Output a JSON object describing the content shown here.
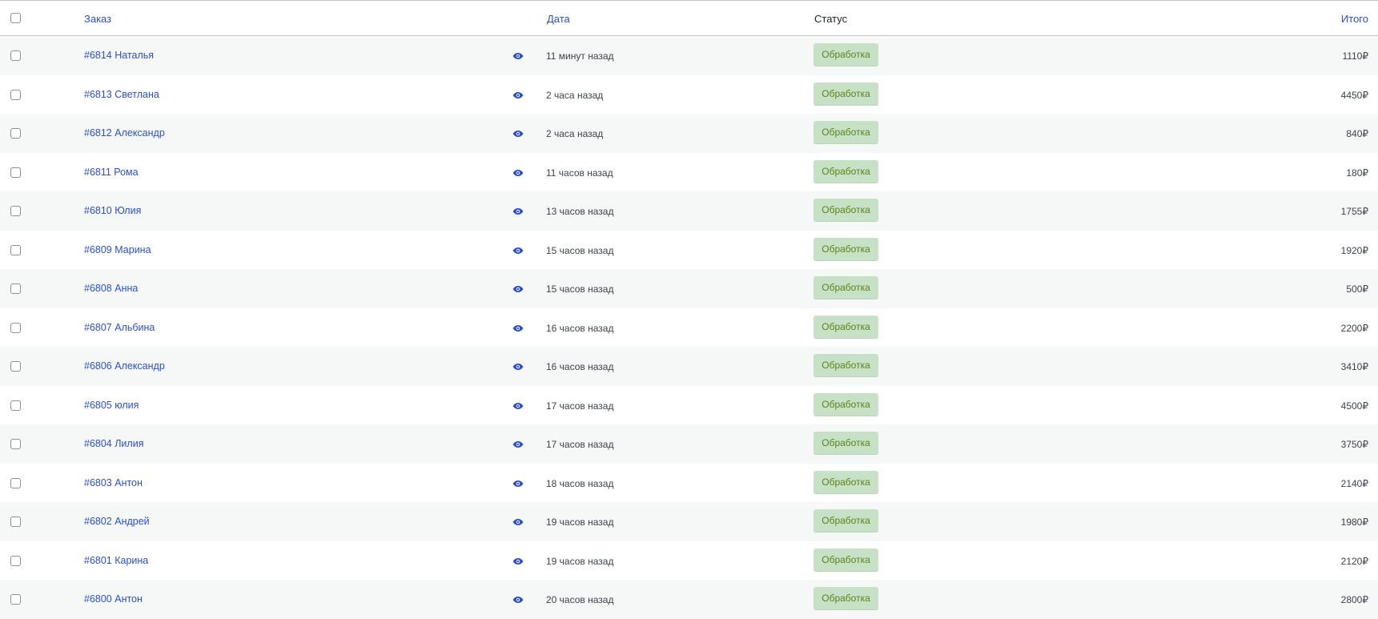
{
  "table": {
    "headers": {
      "order": "Заказ",
      "date": "Дата",
      "status": "Статус",
      "total": "Итого"
    },
    "preview_icon": "eye-icon",
    "status_color": "#c6e1c6",
    "status_text_color": "#5b841b",
    "link_color": "#2c4fd1",
    "rows": [
      {
        "order": "#6814 Наталья",
        "date": "11 минут назад",
        "status": "Обработка",
        "total": "1110₽"
      },
      {
        "order": "#6813 Светлана",
        "date": "2 часа назад",
        "status": "Обработка",
        "total": "4450₽"
      },
      {
        "order": "#6812 Александр",
        "date": "2 часа назад",
        "status": "Обработка",
        "total": "840₽"
      },
      {
        "order": "#6811 Рома",
        "date": "11 часов назад",
        "status": "Обработка",
        "total": "180₽"
      },
      {
        "order": "#6810 Юлия",
        "date": "13 часов назад",
        "status": "Обработка",
        "total": "1755₽"
      },
      {
        "order": "#6809 Марина",
        "date": "15 часов назад",
        "status": "Обработка",
        "total": "1920₽"
      },
      {
        "order": "#6808 Анна",
        "date": "15 часов назад",
        "status": "Обработка",
        "total": "500₽"
      },
      {
        "order": "#6807 Альбина",
        "date": "16 часов назад",
        "status": "Обработка",
        "total": "2200₽"
      },
      {
        "order": "#6806 Александр",
        "date": "16 часов назад",
        "status": "Обработка",
        "total": "3410₽"
      },
      {
        "order": "#6805 юлия",
        "date": "17 часов назад",
        "status": "Обработка",
        "total": "4500₽"
      },
      {
        "order": "#6804 Лилия",
        "date": "17 часов назад",
        "status": "Обработка",
        "total": "3750₽"
      },
      {
        "order": "#6803 Антон",
        "date": "18 часов назад",
        "status": "Обработка",
        "total": "2140₽"
      },
      {
        "order": "#6802 Андрей",
        "date": "19 часов назад",
        "status": "Обработка",
        "total": "1980₽"
      },
      {
        "order": "#6801 Карина",
        "date": "19 часов назад",
        "status": "Обработка",
        "total": "2120₽"
      },
      {
        "order": "#6800 Антон",
        "date": "20 часов назад",
        "status": "Обработка",
        "total": "2800₽"
      }
    ]
  }
}
